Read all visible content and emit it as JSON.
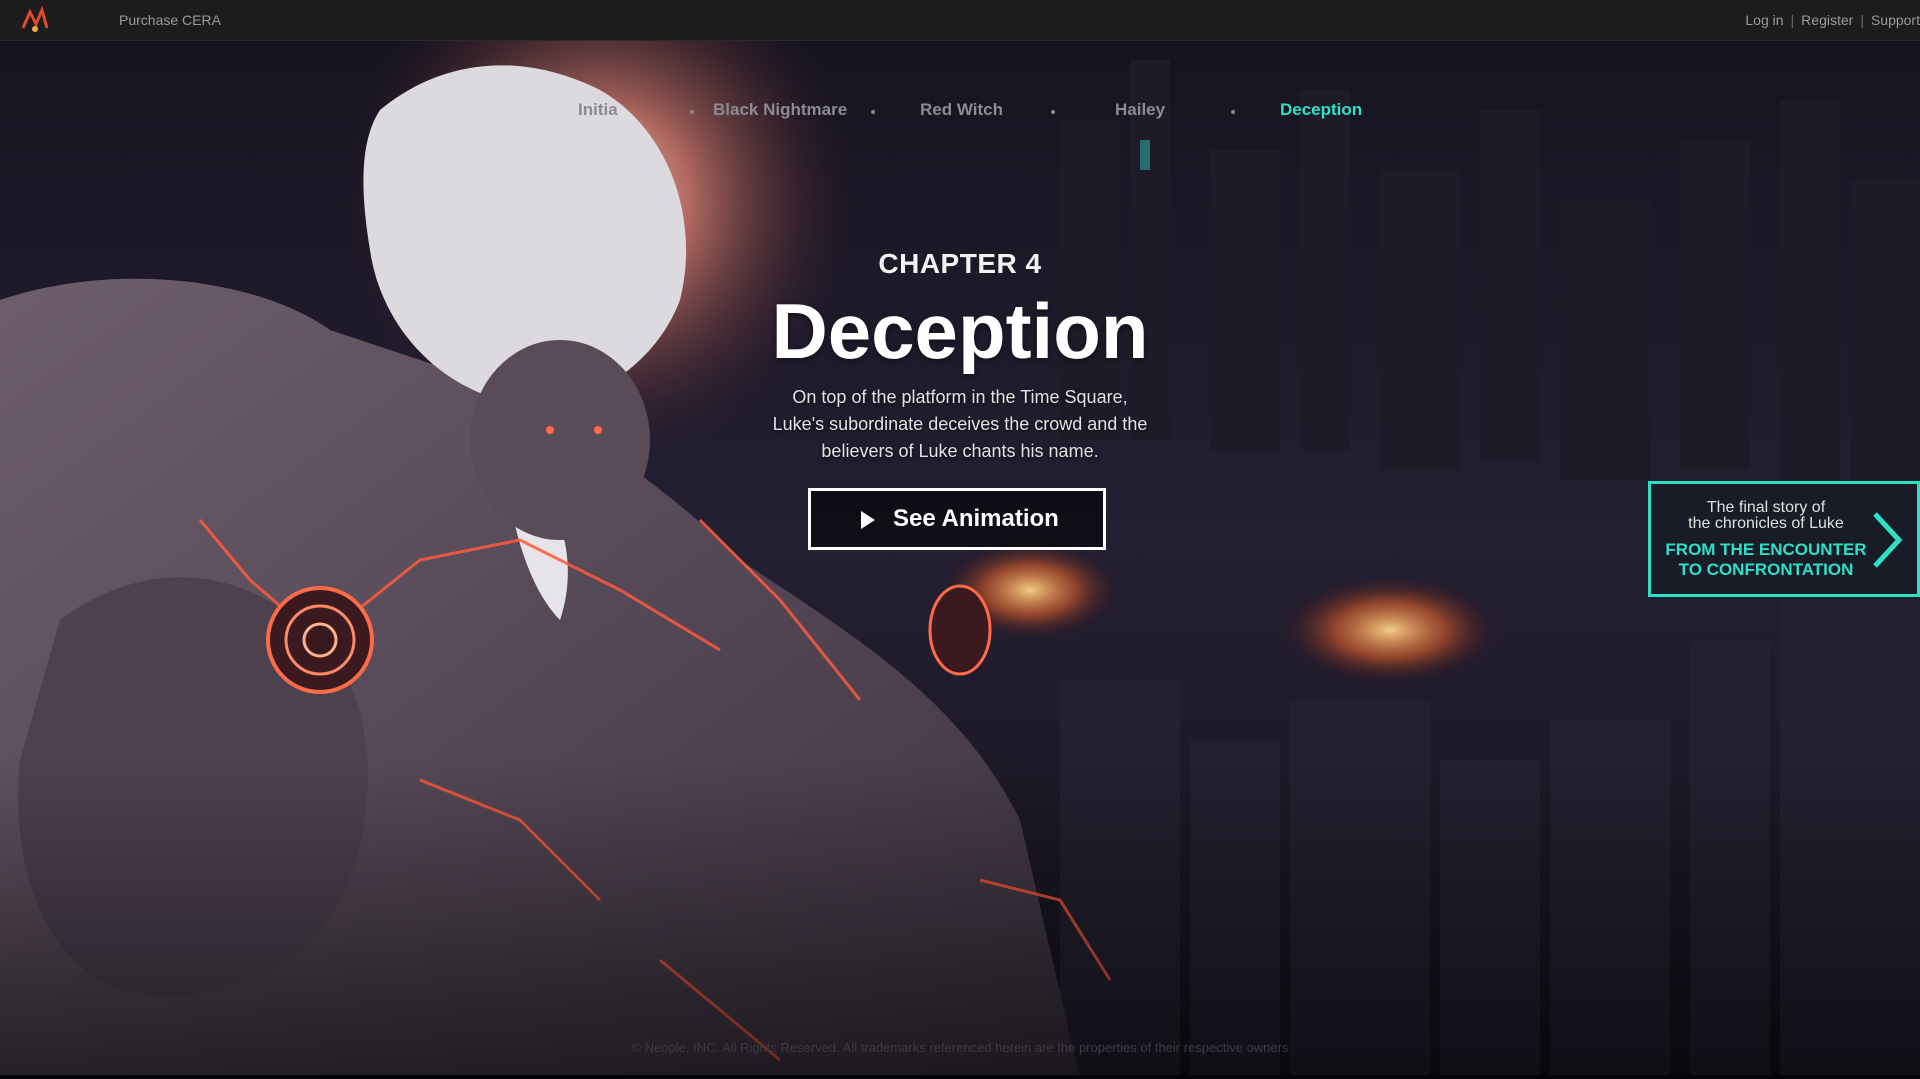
{
  "topbar": {
    "purchase_label": "Purchase CERA",
    "links": {
      "login": "Log in",
      "separator": "|",
      "register": "Register",
      "support": "Support"
    }
  },
  "chapter_nav": {
    "items": [
      {
        "label": "Initia",
        "active": false
      },
      {
        "label": "Black Nightmare",
        "active": false
      },
      {
        "label": "Red Witch",
        "active": false
      },
      {
        "label": "Hailey",
        "active": false
      },
      {
        "label": "Deception",
        "active": true
      }
    ]
  },
  "hero": {
    "chapter": "CHAPTER 4",
    "title": "Deception",
    "description": "On top of the platform in the Time Square, Luke's subordinate deceives the crowd and the believers of Luke chants his name.",
    "button_label": "See Animation"
  },
  "promo": {
    "line1a": "The final story of",
    "line1b": "the chronicles of Luke",
    "line2a": "FROM THE ENCOUNTER",
    "line2b": "TO CONFRONTATION"
  },
  "footer": {
    "copyright": "© Neople, INC. All Rights Reserved. All trademarks referenced herein are the properties of their respective owners"
  },
  "colors": {
    "accent": "#2ee0c8",
    "topbar": "#1c1c1e",
    "nav_inactive": "#8c8a92",
    "background": "#0d0b14"
  },
  "icons": {
    "logo": "dnf-logo-icon",
    "play": "play-icon",
    "next": "chevron-right-icon"
  }
}
